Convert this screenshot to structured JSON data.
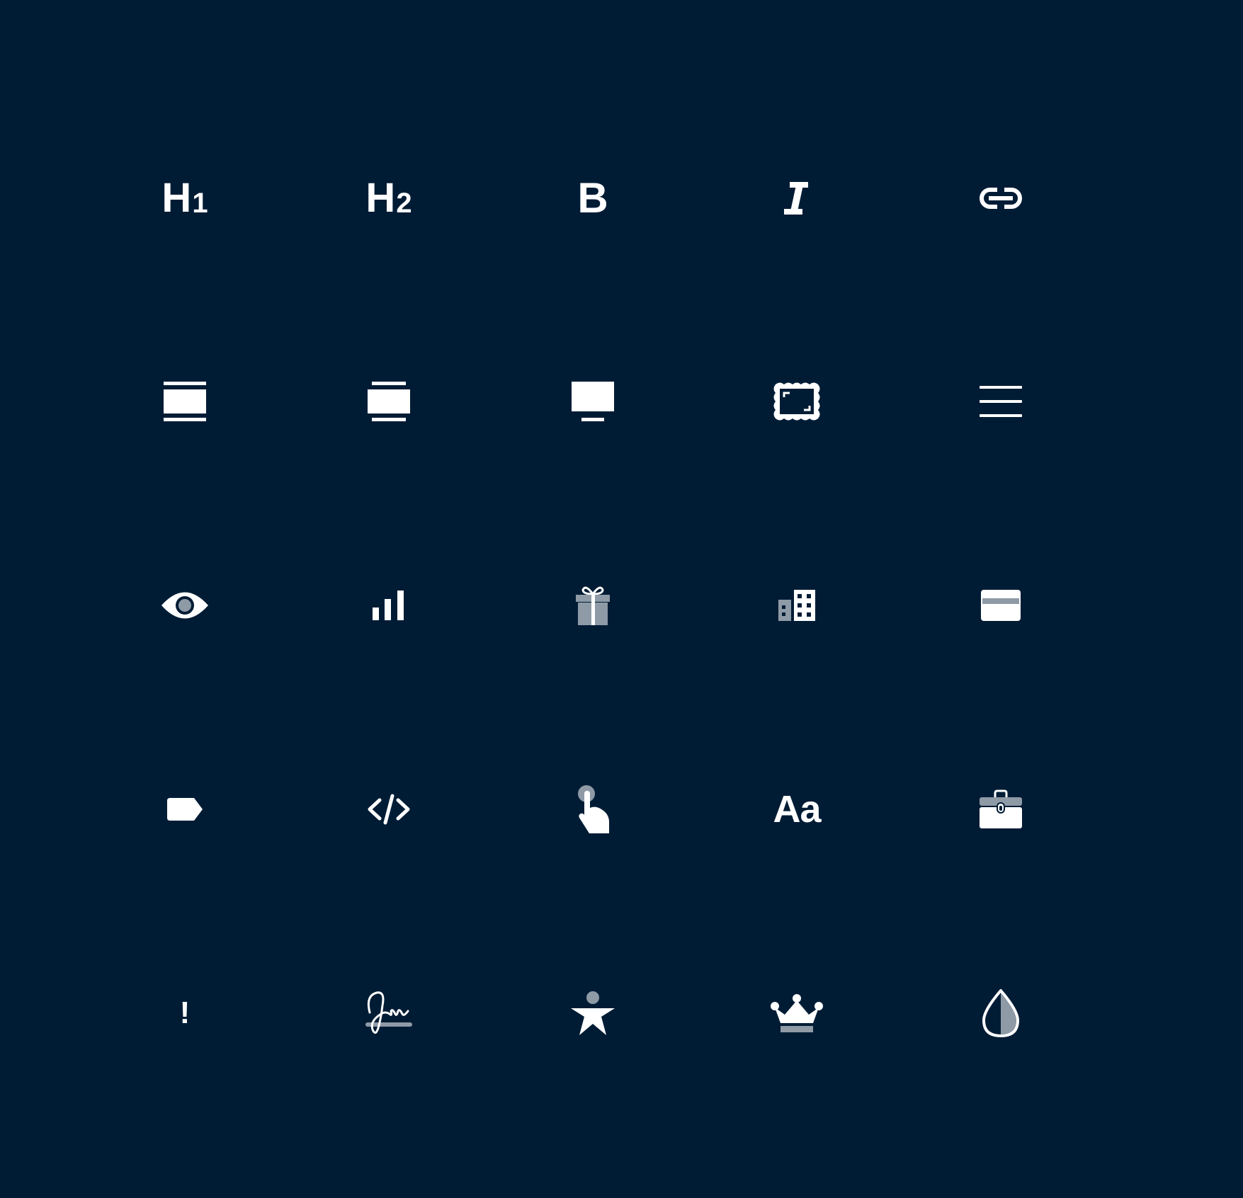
{
  "colors": {
    "background": "#001c35",
    "icon_primary": "#ffffff",
    "icon_secondary": "#8e9aa6"
  },
  "icons": [
    {
      "name": "heading-1-icon",
      "glyph_main": "H",
      "glyph_sub": "1"
    },
    {
      "name": "heading-2-icon",
      "glyph_main": "H",
      "glyph_sub": "2"
    },
    {
      "name": "bold-icon",
      "glyph_main": "B"
    },
    {
      "name": "italic-icon"
    },
    {
      "name": "link-icon"
    },
    {
      "name": "layout-full-width-icon"
    },
    {
      "name": "layout-contained-icon"
    },
    {
      "name": "display-monitor-icon"
    },
    {
      "name": "framed-image-icon"
    },
    {
      "name": "menu-lines-icon"
    },
    {
      "name": "eye-icon"
    },
    {
      "name": "bar-chart-icon"
    },
    {
      "name": "gift-icon"
    },
    {
      "name": "building-icon"
    },
    {
      "name": "credit-card-icon"
    },
    {
      "name": "tag-icon"
    },
    {
      "name": "code-icon"
    },
    {
      "name": "tap-pointer-icon"
    },
    {
      "name": "typography-icon",
      "glyph_main": "Aa"
    },
    {
      "name": "briefcase-icon"
    },
    {
      "name": "exclamation-icon",
      "glyph_main": "!"
    },
    {
      "name": "signature-icon"
    },
    {
      "name": "accessibility-star-icon"
    },
    {
      "name": "crown-icon"
    },
    {
      "name": "water-drop-icon"
    }
  ]
}
